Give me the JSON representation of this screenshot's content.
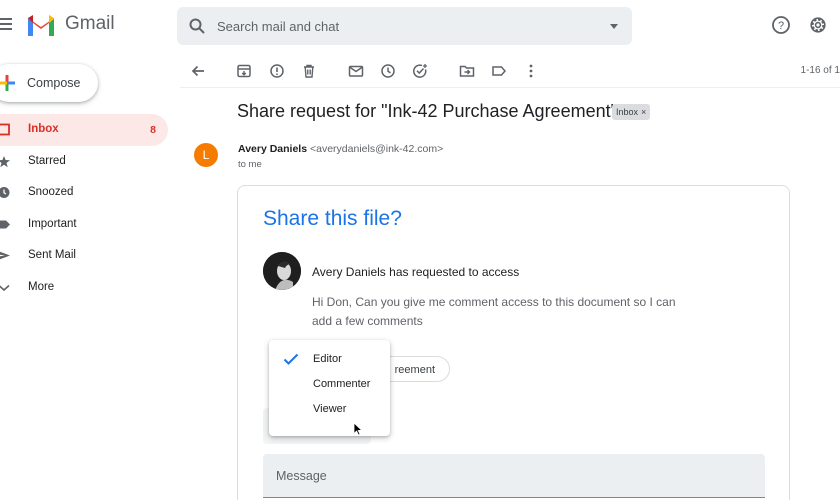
{
  "app": {
    "brand": "Gmail"
  },
  "search": {
    "placeholder": "Search mail and chat"
  },
  "sidebar": {
    "compose_label": "Compose",
    "items": [
      {
        "label": "Inbox",
        "count": "8",
        "icon": "inbox-icon",
        "active": true
      },
      {
        "label": "Starred",
        "icon": "star-icon"
      },
      {
        "label": "Snoozed",
        "icon": "clock-icon"
      },
      {
        "label": "Important",
        "icon": "important-icon"
      },
      {
        "label": "Sent Mail",
        "icon": "send-icon"
      },
      {
        "label": "More",
        "icon": "chevron-down-icon"
      }
    ]
  },
  "toolbar": {
    "icons": [
      "back-arrow-icon",
      "archive-icon",
      "report-spam-icon",
      "delete-icon",
      "mark-unread-icon",
      "snooze-icon",
      "add-task-icon",
      "move-to-icon",
      "label-icon",
      "more-vert-icon"
    ],
    "pager": "1-16 of 1"
  },
  "email": {
    "subject": "Share request for \"Ink-42 Purchase Agreement\"",
    "tag": "Inbox",
    "tag_close": "×",
    "avatar_letter": "L",
    "sender_name": "Avery Daniels",
    "sender_email": "<averydaniels@ink-42.com>",
    "to": "to me"
  },
  "card": {
    "title": "Share this file?",
    "request_text": "Avery Daniels has requested to access",
    "message": "Hi Don, Can you give me comment access to this document so I can add a few comments",
    "file_chip_visible": "reement",
    "message_placeholder": "Message"
  },
  "role_dropdown": {
    "options": [
      "Editor",
      "Commenter",
      "Viewer"
    ],
    "selected": "Editor"
  },
  "colors": {
    "accent_blue": "#1a73e8",
    "inbox_red": "#d93025",
    "inbox_active_bg": "#fce8e6",
    "avatar_orange": "#f57c00"
  }
}
